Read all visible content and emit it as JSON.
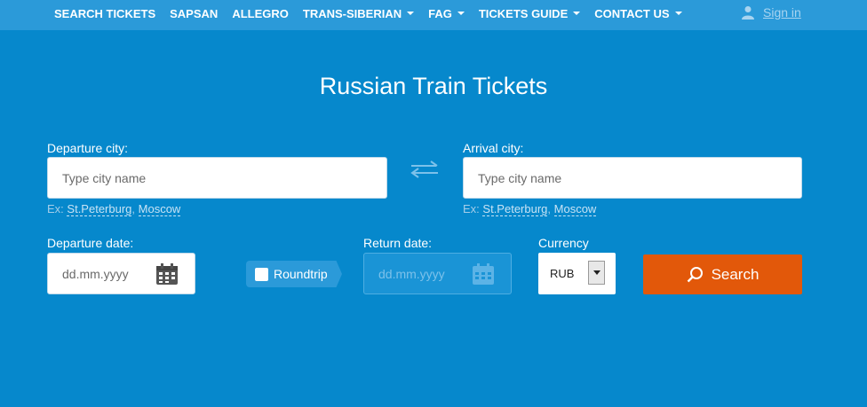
{
  "nav": {
    "items": [
      {
        "label": "SEARCH TICKETS",
        "dropdown": false
      },
      {
        "label": "SAPSAN",
        "dropdown": false
      },
      {
        "label": "ALLEGRO",
        "dropdown": false
      },
      {
        "label": "TRANS-SIBERIAN",
        "dropdown": true
      },
      {
        "label": "FAG",
        "dropdown": true
      },
      {
        "label": "TICKETS GUIDE",
        "dropdown": true
      },
      {
        "label": "CONTACT US",
        "dropdown": true
      }
    ],
    "signin": "Sign in",
    "user_icon": "user-icon"
  },
  "main": {
    "title": "Russian Train Tickets",
    "departure_city": {
      "label": "Departure city:",
      "placeholder": "Type city name",
      "example_prefix": "Ex: ",
      "example_1": "St.Peterburg",
      "example_sep": ", ",
      "example_2": "Moscow"
    },
    "arrival_city": {
      "label": "Arrival city:",
      "placeholder": "Type city name",
      "example_prefix": "Ex: ",
      "example_1": "St.Peterburg",
      "example_sep": ", ",
      "example_2": "Moscow"
    },
    "departure_date": {
      "label": "Departure date:",
      "placeholder": "dd.mm.yyyy"
    },
    "roundtrip": {
      "label": "Roundtrip",
      "checked": false
    },
    "return_date": {
      "label": "Return date:",
      "placeholder": "dd.mm.yyyy"
    },
    "currency": {
      "label": "Currency",
      "value": "RUB"
    },
    "search_button": "Search"
  },
  "colors": {
    "background": "#0688cc",
    "topbar": "#2b9ad9",
    "search_button": "#e2580a"
  }
}
